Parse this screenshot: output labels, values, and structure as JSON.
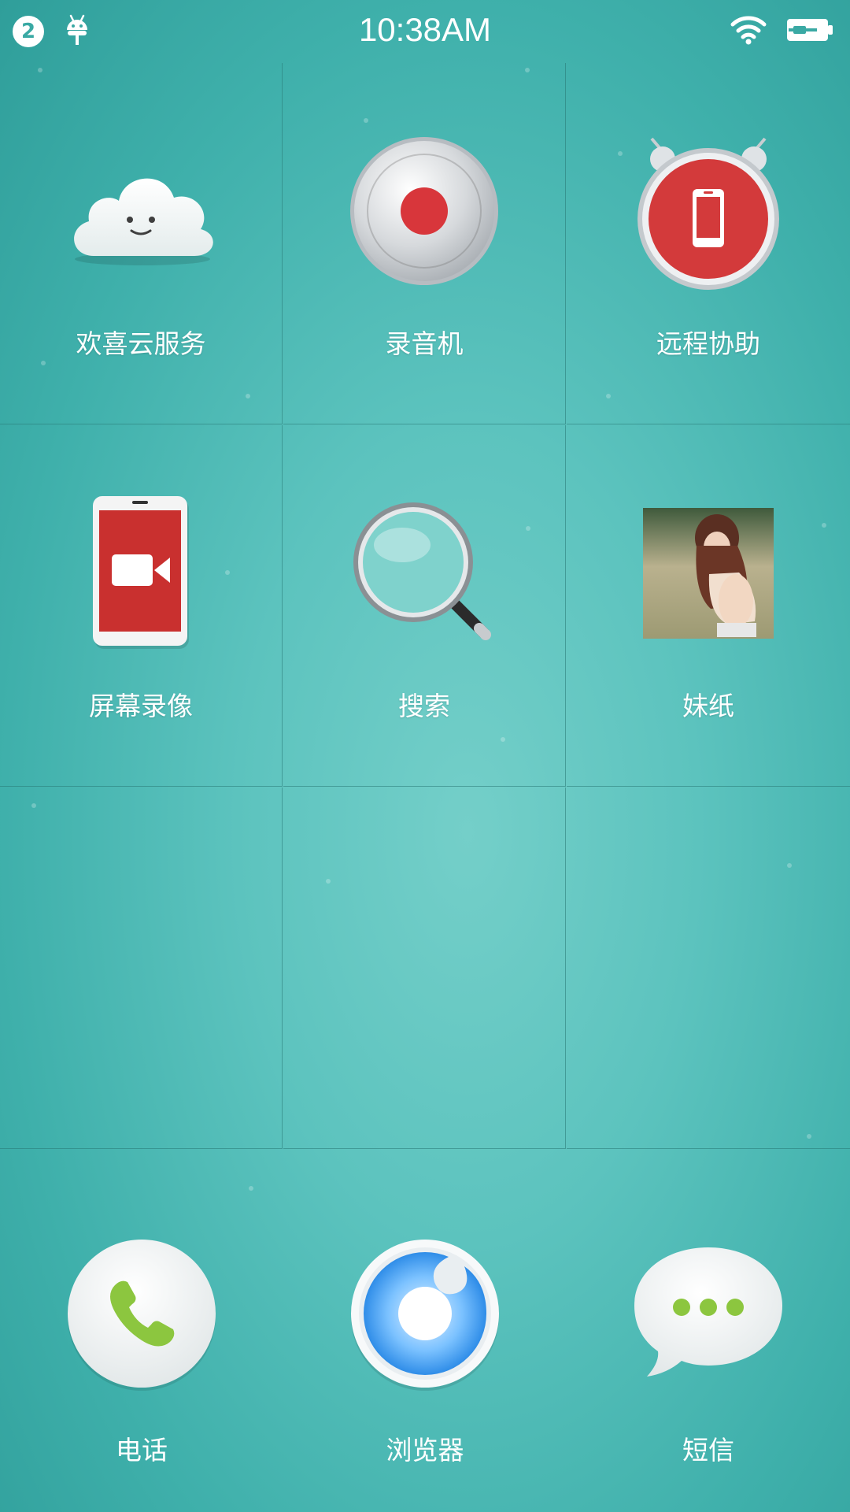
{
  "status_bar": {
    "notification_count": "2",
    "time": "10:38AM",
    "icons": [
      "android-debug-icon",
      "wifi-icon",
      "battery-charging-icon"
    ]
  },
  "grid": {
    "apps": [
      {
        "label": "欢喜云服务",
        "icon": "cloud-icon"
      },
      {
        "label": "录音机",
        "icon": "recorder-icon"
      },
      {
        "label": "远程协助",
        "icon": "remote-assist-icon"
      },
      {
        "label": "屏幕录像",
        "icon": "screen-record-icon"
      },
      {
        "label": "搜索",
        "icon": "magnifier-icon"
      },
      {
        "label": "妹纸",
        "icon": "photo-thumbnail"
      }
    ]
  },
  "dock": {
    "apps": [
      {
        "label": "电话",
        "icon": "phone-icon"
      },
      {
        "label": "浏览器",
        "icon": "browser-icon"
      },
      {
        "label": "短信",
        "icon": "sms-icon"
      }
    ]
  },
  "colors": {
    "background": "#5cc3be",
    "accent_red": "#d8363b",
    "accent_green": "#8cc63f",
    "accent_blue": "#3b9df0"
  }
}
